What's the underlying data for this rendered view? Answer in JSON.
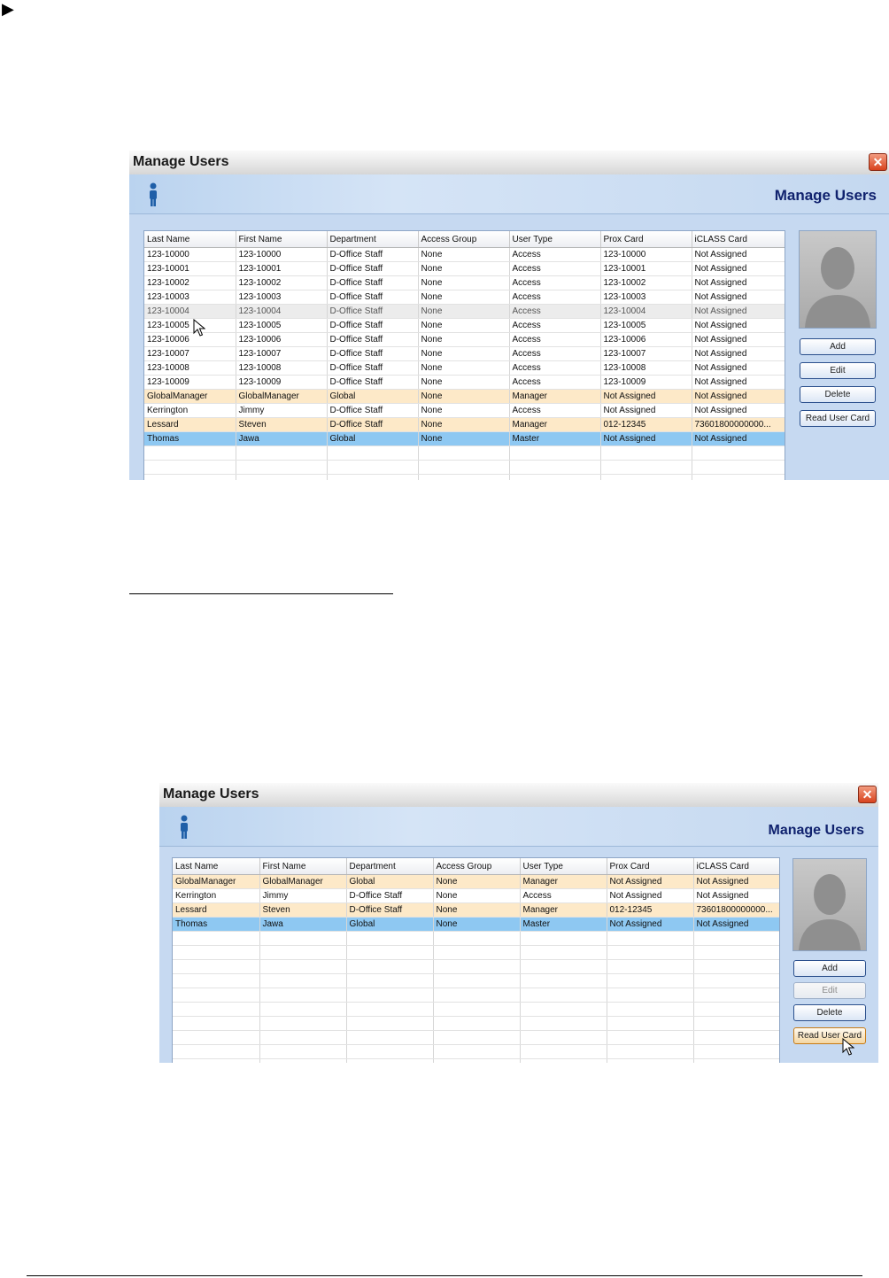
{
  "bullet_glyph": "▶",
  "window1": {
    "title": "Manage Users",
    "header": "Manage Users",
    "close_glyph": "✕",
    "columns": [
      "Last Name",
      "First Name",
      "Department",
      "Access Group",
      "User Type",
      "Prox Card",
      "iCLASS Card"
    ],
    "rows": [
      [
        "123-10000",
        "123-10000",
        "D-Office Staff",
        "None",
        "Access",
        "123-10000",
        "Not Assigned"
      ],
      [
        "123-10001",
        "123-10001",
        "D-Office Staff",
        "None",
        "Access",
        "123-10001",
        "Not Assigned"
      ],
      [
        "123-10002",
        "123-10002",
        "D-Office Staff",
        "None",
        "Access",
        "123-10002",
        "Not Assigned"
      ],
      [
        "123-10003",
        "123-10003",
        "D-Office Staff",
        "None",
        "Access",
        "123-10003",
        "Not Assigned"
      ],
      [
        "123-10004",
        "123-10004",
        "D-Office Staff",
        "None",
        "Access",
        "123-10004",
        "Not Assigned"
      ],
      [
        "123-10005",
        "123-10005",
        "D-Office Staff",
        "None",
        "Access",
        "123-10005",
        "Not Assigned"
      ],
      [
        "123-10006",
        "123-10006",
        "D-Office Staff",
        "None",
        "Access",
        "123-10006",
        "Not Assigned"
      ],
      [
        "123-10007",
        "123-10007",
        "D-Office Staff",
        "None",
        "Access",
        "123-10007",
        "Not Assigned"
      ],
      [
        "123-10008",
        "123-10008",
        "D-Office Staff",
        "None",
        "Access",
        "123-10008",
        "Not Assigned"
      ],
      [
        "123-10009",
        "123-10009",
        "D-Office Staff",
        "None",
        "Access",
        "123-10009",
        "Not Assigned"
      ],
      [
        "GlobalManager",
        "GlobalManager",
        "Global",
        "None",
        "Manager",
        "Not Assigned",
        "Not Assigned"
      ],
      [
        "Kerrington",
        "Jimmy",
        "D-Office Staff",
        "None",
        "Access",
        "Not Assigned",
        "Not Assigned"
      ],
      [
        "Lessard",
        "Steven",
        "D-Office Staff",
        "None",
        "Manager",
        "012-12345",
        "73601800000000..."
      ],
      [
        "Thomas",
        "Jawa",
        "Global",
        "None",
        "Master",
        "Not Assigned",
        "Not Assigned"
      ]
    ],
    "row_styles": [
      "",
      "",
      "",
      "",
      "hover",
      "",
      "",
      "",
      "",
      "",
      "manager",
      "",
      "manager",
      "master"
    ],
    "buttons": {
      "add": "Add",
      "edit": "Edit",
      "delete": "Delete",
      "read": "Read User Card"
    }
  },
  "window2": {
    "title": "Manage Users",
    "header": "Manage Users",
    "close_glyph": "✕",
    "columns": [
      "Last Name",
      "First Name",
      "Department",
      "Access Group",
      "User Type",
      "Prox Card",
      "iCLASS Card"
    ],
    "rows": [
      [
        "GlobalManager",
        "GlobalManager",
        "Global",
        "None",
        "Manager",
        "Not Assigned",
        "Not Assigned"
      ],
      [
        "Kerrington",
        "Jimmy",
        "D-Office Staff",
        "None",
        "Access",
        "Not Assigned",
        "Not Assigned"
      ],
      [
        "Lessard",
        "Steven",
        "D-Office Staff",
        "None",
        "Manager",
        "012-12345",
        "73601800000000..."
      ],
      [
        "Thomas",
        "Jawa",
        "Global",
        "None",
        "Master",
        "Not Assigned",
        "Not Assigned"
      ]
    ],
    "row_styles": [
      "manager",
      "",
      "manager",
      "master"
    ],
    "buttons": {
      "add": "Add",
      "edit": "Edit",
      "delete": "Delete",
      "read": "Read User Card"
    },
    "edit_disabled": true
  }
}
